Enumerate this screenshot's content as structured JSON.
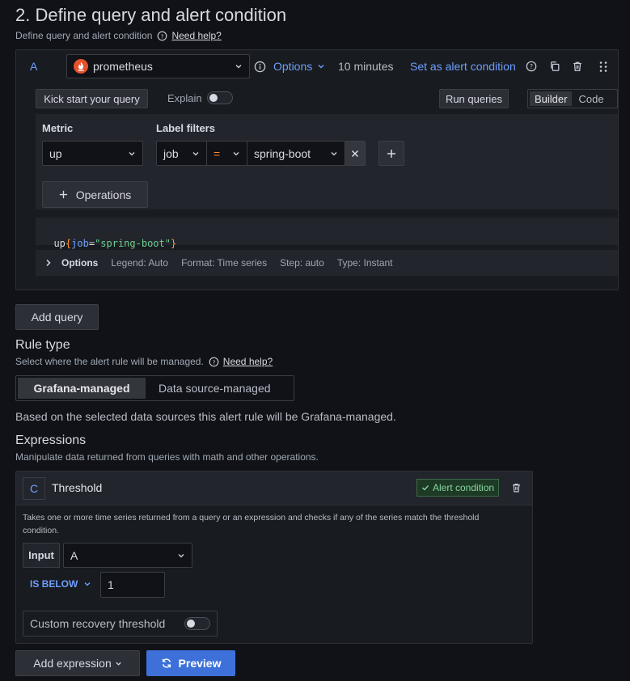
{
  "section": {
    "title": "2. Define query and alert condition",
    "subtitle": "Define query and alert condition",
    "help_link": "Need help?"
  },
  "query": {
    "ref_id": "A",
    "datasource": "prometheus",
    "options_label": "Options",
    "time_range": "10 minutes",
    "set_alert_label": "Set as alert condition",
    "kick_start": "Kick start your query",
    "explain_label": "Explain",
    "run_queries": "Run queries",
    "mode_builder": "Builder",
    "mode_code": "Code",
    "metric_label": "Metric",
    "metric_value": "up",
    "label_filters_label": "Label filters",
    "filter_key": "job",
    "filter_op": "=",
    "filter_value": "spring-boot",
    "operations_label": "Operations",
    "preview": {
      "metric": "up",
      "open_brace": "{",
      "key": "job",
      "eq": "=",
      "value": "\"spring-boot\"",
      "close_brace": "}"
    },
    "options_row": {
      "label": "Options",
      "legend": "Legend: Auto",
      "format": "Format: Time series",
      "step": "Step: auto",
      "type": "Type: Instant"
    }
  },
  "add_query": "Add query",
  "rule_type": {
    "title": "Rule type",
    "subtitle": "Select where the alert rule will be managed.",
    "help_link": "Need help?",
    "option_grafana": "Grafana-managed",
    "option_datasource": "Data source-managed",
    "note": "Based on the selected data sources this alert rule will be Grafana-managed."
  },
  "expressions": {
    "title": "Expressions",
    "subtitle": "Manipulate data returned from queries with math and other operations.",
    "ref_id": "C",
    "name": "Threshold",
    "alert_badge": "Alert condition",
    "description": "Takes one or more time series returned from a query or an expression and checks if any of the series match the threshold condition.",
    "input_label": "Input",
    "input_value": "A",
    "condition": "IS BELOW",
    "threshold_value": "1",
    "recovery_label": "Custom recovery threshold"
  },
  "footer": {
    "add_expression": "Add expression",
    "preview": "Preview"
  },
  "colors": {
    "background": "#111217",
    "primary": "#3d71d9",
    "accent_blue": "#6e9fff",
    "success": "#6ccf8e"
  }
}
